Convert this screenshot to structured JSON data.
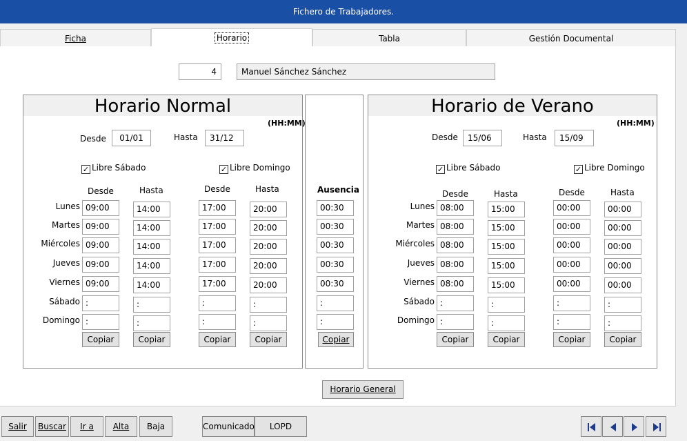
{
  "window": {
    "title": "Fichero de Trabajadores."
  },
  "tabs": [
    "Ficha",
    "Horario",
    "Tabla",
    "Gestión Documental"
  ],
  "employee": {
    "id": "4",
    "name": "Manuel Sánchez Sánchez"
  },
  "normal": {
    "title": "Horario Normal",
    "units": "(HH:MM)",
    "desde_label": "Desde",
    "desde": "01/01",
    "hasta_label": "Hasta",
    "hasta": "31/12",
    "libre_sabado": "Libre Sábado",
    "libre_domingo": "Libre Domingo",
    "col_desde": "Desde",
    "col_hasta": "Hasta",
    "days": [
      "Lunes",
      "Martes",
      "Miércoles",
      "Jueves",
      "Viernes",
      "Sábado",
      "Domingo"
    ],
    "rows": [
      [
        "09:00",
        "14:00",
        "17:00",
        "20:00"
      ],
      [
        "09:00",
        "14:00",
        "17:00",
        "20:00"
      ],
      [
        "09:00",
        "14:00",
        "17:00",
        "20:00"
      ],
      [
        "09:00",
        "14:00",
        "17:00",
        "20:00"
      ],
      [
        "09:00",
        "14:00",
        "17:00",
        "20:00"
      ],
      [
        ":",
        ":",
        ":",
        ":"
      ],
      [
        ":",
        ":",
        ":",
        ":"
      ]
    ],
    "copy_label": "Copiar"
  },
  "ausencia": {
    "title": "Ausencia",
    "values": [
      "00:30",
      "00:30",
      "00:30",
      "00:30",
      "00:30",
      ":",
      ":"
    ],
    "copy_label": "Copiar"
  },
  "verano": {
    "title": "Horario de Verano",
    "units": "(HH:MM)",
    "desde_label": "Desde",
    "desde": "15/06",
    "hasta_label": "Hasta",
    "hasta": "15/09",
    "libre_sabado": "Libre Sábado",
    "libre_domingo": "Libre Domingo",
    "col_desde": "Desde",
    "col_hasta": "Hasta",
    "days": [
      "Lunes",
      "Martes",
      "Miércoles",
      "Jueves",
      "Viernes",
      "Sábado",
      "Domingo"
    ],
    "rows": [
      [
        "08:00",
        "15:00",
        "00:00",
        "00:00"
      ],
      [
        "08:00",
        "15:00",
        "00:00",
        "00:00"
      ],
      [
        "08:00",
        "15:00",
        "00:00",
        "00:00"
      ],
      [
        "08:00",
        "15:00",
        "00:00",
        "00:00"
      ],
      [
        "08:00",
        "15:00",
        "00:00",
        "00:00"
      ],
      [
        ":",
        ":",
        ":",
        ":"
      ],
      [
        ":",
        ":",
        ":",
        ":"
      ]
    ],
    "copy_label": "Copiar"
  },
  "horario_general": "Horario General",
  "bottom": {
    "salir": "Salir",
    "buscar": "Buscar",
    "ira": "Ir a",
    "alta": "Alta",
    "baja": "Baja",
    "comunicado": "Comunicado",
    "lopd": "LOPD"
  }
}
